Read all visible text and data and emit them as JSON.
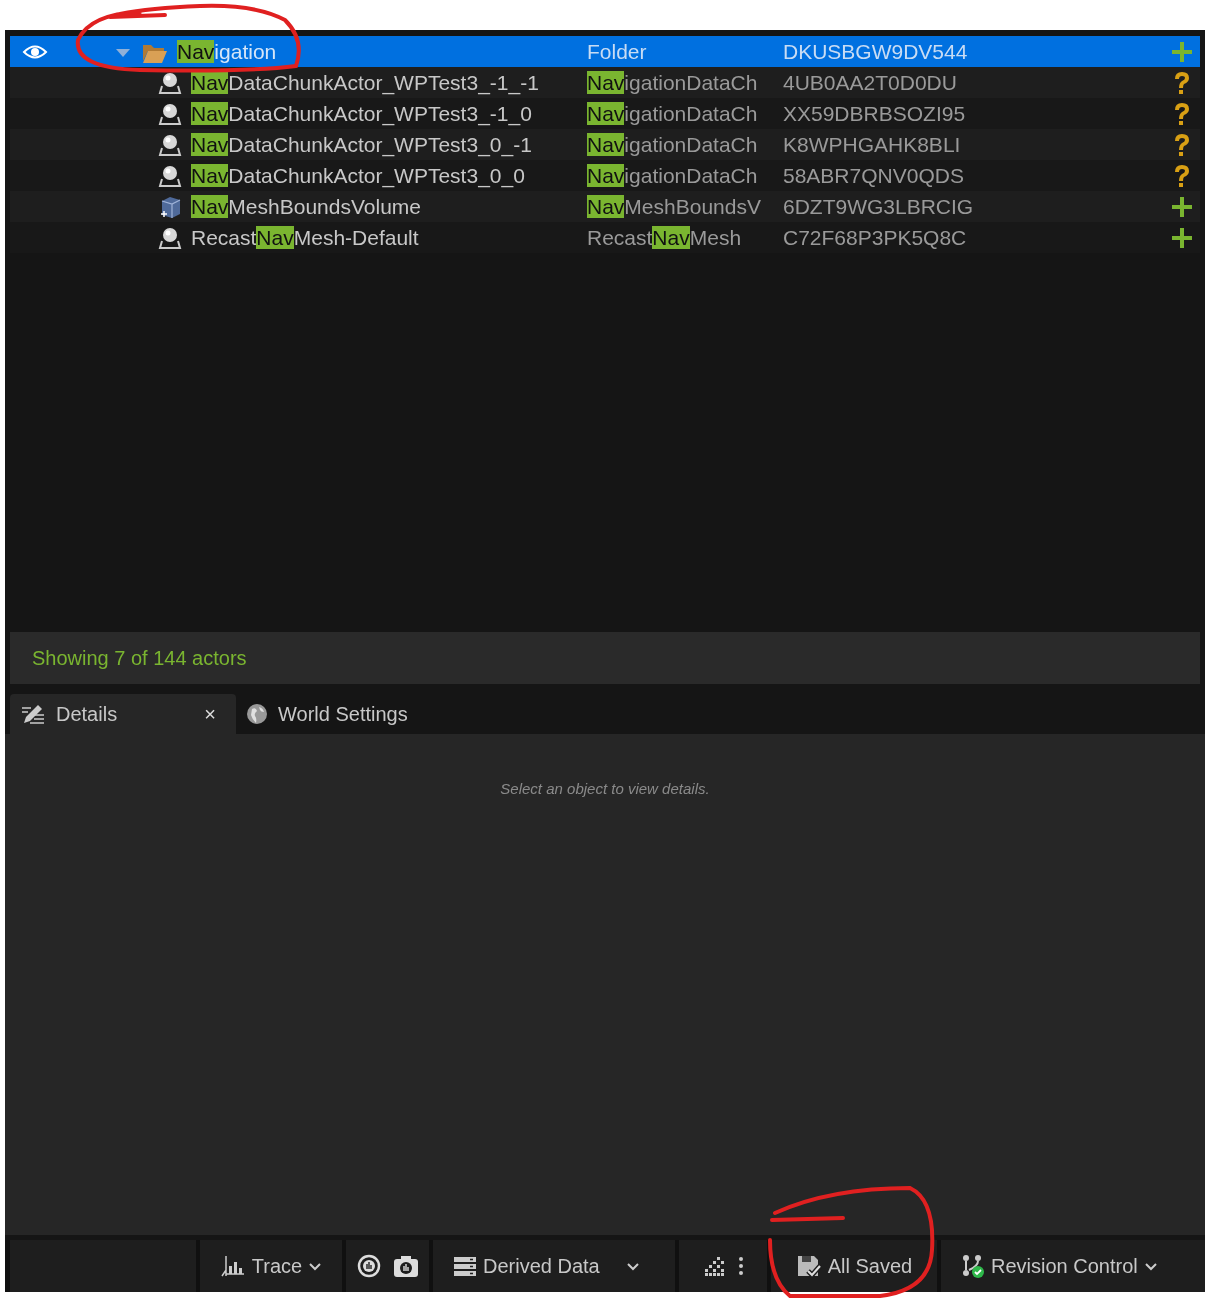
{
  "outliner": {
    "rows": [
      {
        "name_parts": [
          {
            "text": "Nav",
            "match": true
          },
          {
            "text": "igation",
            "match": false
          }
        ],
        "type_parts": [
          {
            "text": "Folder",
            "match": false
          }
        ],
        "id": "DKUSBGW9DV544",
        "kind": "folder",
        "visible": true,
        "expanded": true,
        "selected": true,
        "added": true,
        "children": [
          {
            "name_parts": [
              {
                "text": "Nav",
                "match": true
              },
              {
                "text": "DataChunkActor_WPTest3_-1_-1",
                "match": false
              }
            ],
            "type_parts": [
              {
                "text": "Nav",
                "match": true
              },
              {
                "text": "igationDataCh",
                "match": false
              }
            ],
            "id": "4UB0AA2T0D0DU",
            "kind": "actor",
            "visible": false,
            "selected": false,
            "added": false
          },
          {
            "name_parts": [
              {
                "text": "Nav",
                "match": true
              },
              {
                "text": "DataChunkActor_WPTest3_-1_0",
                "match": false
              }
            ],
            "type_parts": [
              {
                "text": "Nav",
                "match": true
              },
              {
                "text": "igationDataCh",
                "match": false
              }
            ],
            "id": "XX59DBRBSOZI95",
            "kind": "actor",
            "visible": false,
            "selected": false,
            "added": false
          },
          {
            "name_parts": [
              {
                "text": "Nav",
                "match": true
              },
              {
                "text": "DataChunkActor_WPTest3_0_-1",
                "match": false
              }
            ],
            "type_parts": [
              {
                "text": "Nav",
                "match": true
              },
              {
                "text": "igationDataCh",
                "match": false
              }
            ],
            "id": "K8WPHGAHK8BLI",
            "kind": "actor",
            "visible": false,
            "selected": false,
            "added": false
          },
          {
            "name_parts": [
              {
                "text": "Nav",
                "match": true
              },
              {
                "text": "DataChunkActor_WPTest3_0_0",
                "match": false
              }
            ],
            "type_parts": [
              {
                "text": "Nav",
                "match": true
              },
              {
                "text": "igationDataCh",
                "match": false
              }
            ],
            "id": "58ABR7QNV0QDS",
            "kind": "actor",
            "visible": false,
            "selected": false,
            "added": false
          },
          {
            "name_parts": [
              {
                "text": "Nav",
                "match": true
              },
              {
                "text": "MeshBoundsVolume",
                "match": false
              }
            ],
            "type_parts": [
              {
                "text": "Nav",
                "match": true
              },
              {
                "text": "MeshBoundsV",
                "match": false
              }
            ],
            "id": "6DZT9WG3LBRCIG",
            "kind": "volume",
            "visible": false,
            "selected": false,
            "added": true
          },
          {
            "name_parts": [
              {
                "text": "Recast",
                "match": false
              },
              {
                "text": "Nav",
                "match": true
              },
              {
                "text": "Mesh-Default",
                "match": false
              }
            ],
            "type_parts": [
              {
                "text": "Recast",
                "match": false
              },
              {
                "text": "Nav",
                "match": true
              },
              {
                "text": "Mesh",
                "match": false
              }
            ],
            "id": "C72F68P3PK5Q8C",
            "kind": "actor",
            "visible": false,
            "selected": false,
            "added": true
          }
        ]
      }
    ],
    "status_text": "Showing 7 of 144 actors"
  },
  "tabs": [
    {
      "label": "Details",
      "selected": true,
      "close": "×"
    },
    {
      "label": "World Settings",
      "selected": false
    }
  ],
  "details": {
    "message": "Select an object to view details."
  },
  "bottom_bar": [
    {
      "kind": "spacer"
    },
    {
      "kind": "menu",
      "label": "Trace"
    },
    {
      "kind": "icons"
    },
    {
      "kind": "menu",
      "label": "Derived Data"
    },
    {
      "kind": "icons"
    },
    {
      "kind": "button",
      "label": "All Saved"
    },
    {
      "kind": "menu",
      "label": "Revision Control"
    }
  ],
  "annotations": [
    {
      "kind": "circle"
    },
    {
      "kind": "circle"
    }
  ]
}
